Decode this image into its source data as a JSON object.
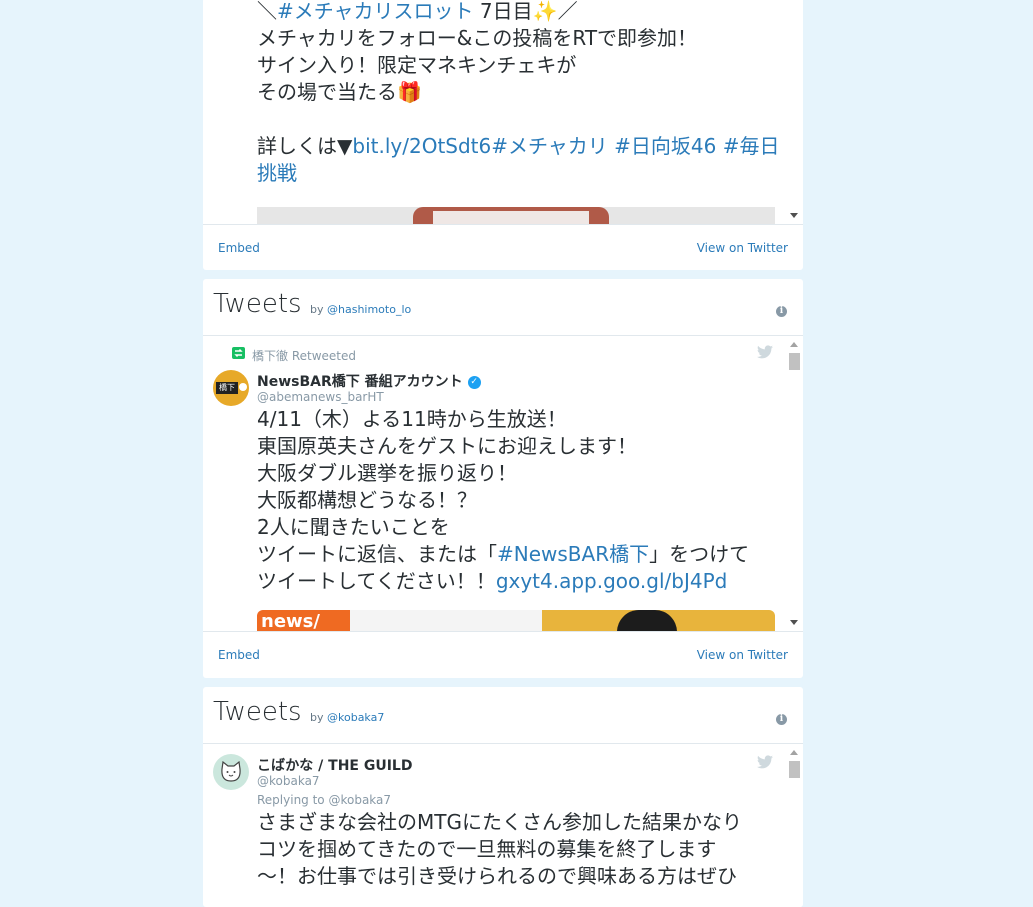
{
  "card1": {
    "text_lines": [
      {
        "parts": [
          {
            "t": "＼"
          },
          {
            "t": "#メチャカリスロット",
            "link": true
          },
          {
            "t": " 7日目"
          },
          {
            "t": "✨"
          },
          {
            "t": "／"
          }
        ]
      },
      {
        "parts": [
          {
            "t": "メチャカリをフォロー&この投稿をRTで即参加！"
          }
        ]
      },
      {
        "parts": [
          {
            "t": "サイン入り！限定マネキンチェキが"
          }
        ]
      },
      {
        "parts": [
          {
            "t": "その場で当たる"
          },
          {
            "t": "🎁"
          }
        ]
      },
      {
        "parts": [
          {
            "t": ""
          }
        ]
      },
      {
        "parts": [
          {
            "t": "詳しくは▼"
          },
          {
            "t": "bit.ly/2OtSdt6",
            "link": true
          },
          {
            "t": "#メチャカリ",
            "link": true
          },
          {
            "t": " "
          },
          {
            "t": "#日向坂46",
            "link": true
          },
          {
            "t": " "
          },
          {
            "t": "#毎日",
            "link": true
          }
        ]
      },
      {
        "parts": [
          {
            "t": "挑戦",
            "link": true
          }
        ]
      }
    ],
    "footer": {
      "embed": "Embed",
      "view": "View on Twitter"
    }
  },
  "card2": {
    "title": "Tweets",
    "by": "by",
    "handle": "@hashimoto_lo",
    "retweeted_by": "橋下徹 Retweeted",
    "author_name": "NewsBAR橋下 番組アカウント",
    "author_handle": "@abemanews_barHT",
    "avatar_text": "橋下",
    "text_lines": [
      {
        "parts": [
          {
            "t": "4/11（木）よる11時から生放送！"
          }
        ]
      },
      {
        "parts": [
          {
            "t": "東国原英夫さんをゲストにお迎えします！"
          }
        ]
      },
      {
        "parts": [
          {
            "t": "大阪ダブル選挙を振り返り！"
          }
        ]
      },
      {
        "parts": [
          {
            "t": "大阪都構想どうなる！？"
          }
        ]
      },
      {
        "parts": [
          {
            "t": "2人に聞きたいことを"
          }
        ]
      },
      {
        "parts": [
          {
            "t": "ツイートに返信、または「"
          },
          {
            "t": "#NewsBAR橋下",
            "link": true
          },
          {
            "t": "」をつけて"
          }
        ]
      },
      {
        "parts": [
          {
            "t": "ツイートしてください！！"
          },
          {
            "t": "gxyt4.app.goo.gl/bJ4Pd",
            "link": true
          }
        ]
      }
    ],
    "media_label": "news/",
    "footer": {
      "embed": "Embed",
      "view": "View on Twitter"
    }
  },
  "card3": {
    "title": "Tweets",
    "by": "by",
    "handle": "@kobaka7",
    "author_name": "こばかな / THE GUILD",
    "author_handle": "@kobaka7",
    "reply_prefix": "Replying to ",
    "reply_handle": "@kobaka7",
    "text_lines": [
      {
        "parts": [
          {
            "t": "さまざまな会社のMTGにたくさん参加した結果かなり"
          }
        ]
      },
      {
        "parts": [
          {
            "t": "コツを掴めてきたので一旦無料の募集を終了します"
          }
        ]
      },
      {
        "parts": [
          {
            "t": "～！お仕事では引き受けられるので興味ある方はぜひ"
          }
        ]
      }
    ]
  },
  "colors": {
    "background": "#e6f4fc",
    "link": "#2b7bb9",
    "text": "#292f33",
    "muted": "#8899a6"
  }
}
